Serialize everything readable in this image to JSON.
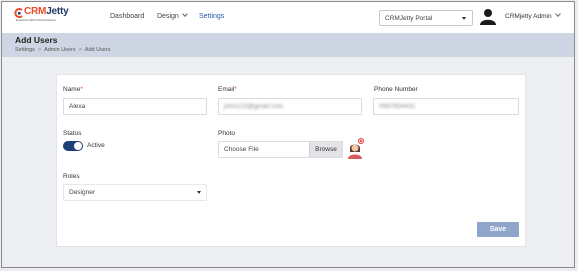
{
  "logo": {
    "brand_crm": "CRM",
    "brand_jetty": "Jetty",
    "tagline": "Enterprise CRM & Portal Solutions"
  },
  "nav": {
    "items": [
      {
        "label": "Dashboard"
      },
      {
        "label": "Design"
      },
      {
        "label": "Settings"
      }
    ],
    "portal_select": "CRMJetty Portal",
    "user_name": "CRMjetty Admin"
  },
  "page": {
    "title": "Add Users",
    "breadcrumb": [
      "Settings",
      "Admin Users",
      "Add Users"
    ],
    "breadcrumb_sep": ">"
  },
  "form": {
    "name_label": "Name",
    "name_value": "Alexa",
    "email_label": "Email",
    "email_value": "john123@gmail.com",
    "phone_label": "Phone Number",
    "phone_value": "0987654432",
    "required_mark": "*",
    "status_label": "Status",
    "status_value": "Active",
    "status_on": true,
    "photo_label": "Photo",
    "photo_placeholder": "Choose File",
    "browse_label": "Browse",
    "roles_label": "Roles",
    "roles_value": "Designer",
    "save_label": "Save"
  },
  "colors": {
    "accent": "#2a56a4",
    "toggle_on": "#1e3f73",
    "save_button": "#8fa5c9",
    "required": "#e23b3b",
    "brand_red": "#e84b2a",
    "brand_navy": "#1e3a66"
  }
}
